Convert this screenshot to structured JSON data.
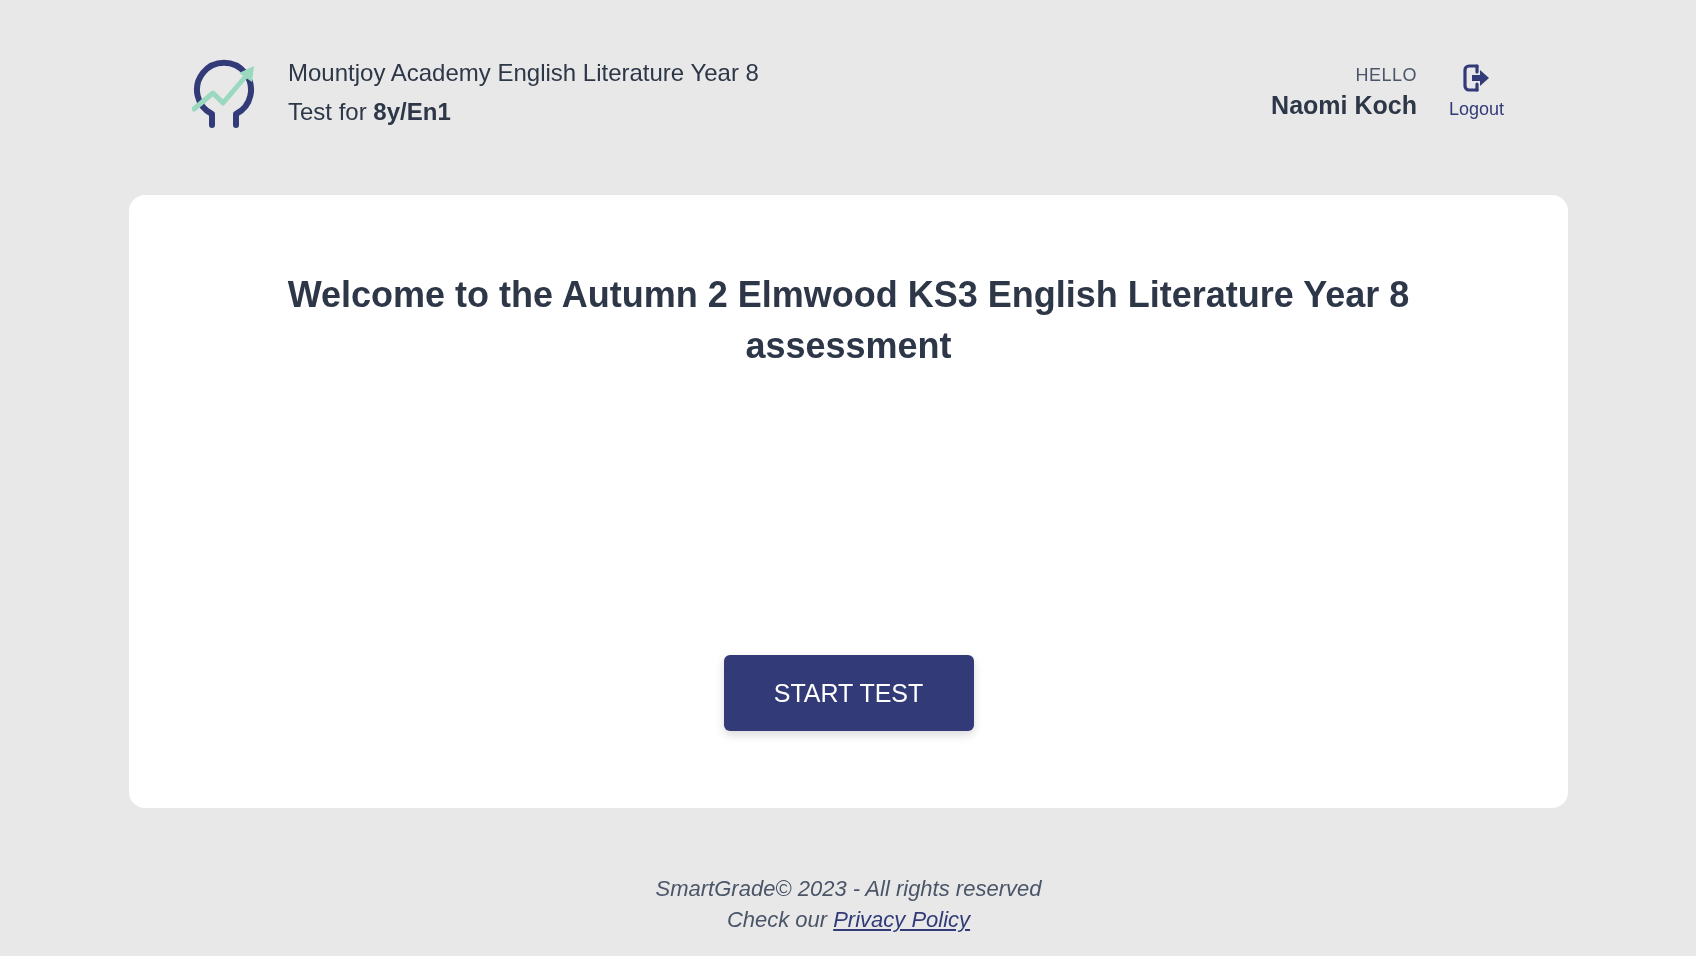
{
  "header": {
    "school_line": "Mountjoy Academy English Literature Year 8",
    "test_line": "Test for **8y/En1**",
    "greeting": "HELLO",
    "user_name": "Naomi Koch",
    "logout_label": "Logout"
  },
  "card": {
    "title": "Welcome to the Autumn 2 Elmwood KS3 English Literature Year 8 assessment",
    "button": "START TEST"
  },
  "footer": {
    "copyright": "SmartGrade© 2023 - All rights reserved",
    "privacy_prefix": "Check our",
    "privacy_link": "Privacy Policy"
  }
}
